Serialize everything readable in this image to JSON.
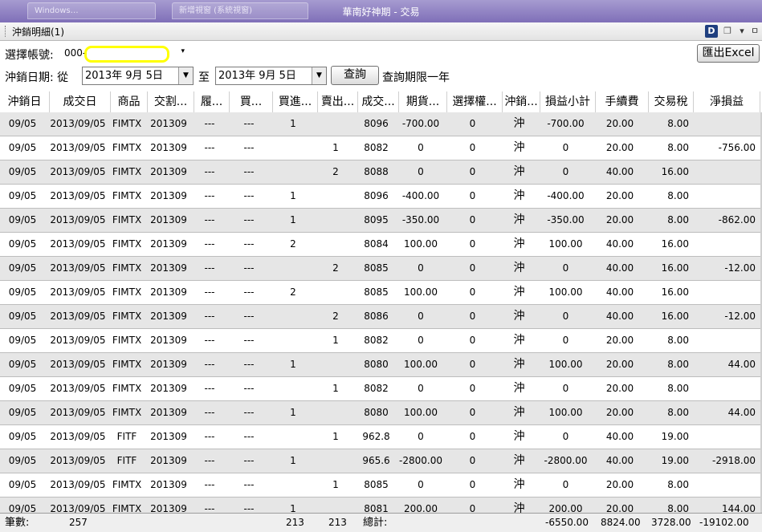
{
  "window": {
    "title": "華南好神期 - 交易",
    "tabs": [
      "Windows…",
      "新增視窗 (系統視窗)"
    ]
  },
  "panel": {
    "title": "沖銷明細(1)",
    "d_badge": "D",
    "window_glyph": "❐",
    "dropdown_glyph": "▾",
    "pin_glyph": "ㅁ"
  },
  "account": {
    "label": "選擇帳號:",
    "value": "000-",
    "arrow": "▾"
  },
  "export_button": "匯出Excel",
  "query": {
    "label": "沖銷日期: 從",
    "from": "2013年  9月  5日",
    "to_label": "至",
    "to": "2013年  9月  5日",
    "arrow": "▼",
    "button": "查詢",
    "note": "查詢期限一年"
  },
  "columns": [
    "沖銷日",
    "成交日",
    "商品",
    "交割...",
    "履...",
    "買...",
    "買進...",
    "賣出...",
    "成交...",
    "期貨...",
    "選擇權...",
    "沖銷...",
    "損益小計",
    "手續費",
    "交易稅",
    "淨損益"
  ],
  "rows": [
    [
      "09/05",
      "2013/09/05",
      "FIMTX",
      "201309",
      "---",
      "---",
      "1",
      "",
      "8096",
      "-700.00",
      "0",
      "沖",
      "-700.00",
      "20.00",
      "8.00",
      ""
    ],
    [
      "09/05",
      "2013/09/05",
      "FIMTX",
      "201309",
      "---",
      "---",
      "",
      "1",
      "8082",
      "0",
      "0",
      "沖",
      "0",
      "20.00",
      "8.00",
      "-756.00"
    ],
    [
      "09/05",
      "2013/09/05",
      "FIMTX",
      "201309",
      "---",
      "---",
      "",
      "2",
      "8088",
      "0",
      "0",
      "沖",
      "0",
      "40.00",
      "16.00",
      ""
    ],
    [
      "09/05",
      "2013/09/05",
      "FIMTX",
      "201309",
      "---",
      "---",
      "1",
      "",
      "8096",
      "-400.00",
      "0",
      "沖",
      "-400.00",
      "20.00",
      "8.00",
      ""
    ],
    [
      "09/05",
      "2013/09/05",
      "FIMTX",
      "201309",
      "---",
      "---",
      "1",
      "",
      "8095",
      "-350.00",
      "0",
      "沖",
      "-350.00",
      "20.00",
      "8.00",
      "-862.00"
    ],
    [
      "09/05",
      "2013/09/05",
      "FIMTX",
      "201309",
      "---",
      "---",
      "2",
      "",
      "8084",
      "100.00",
      "0",
      "沖",
      "100.00",
      "40.00",
      "16.00",
      ""
    ],
    [
      "09/05",
      "2013/09/05",
      "FIMTX",
      "201309",
      "---",
      "---",
      "",
      "2",
      "8085",
      "0",
      "0",
      "沖",
      "0",
      "40.00",
      "16.00",
      "-12.00"
    ],
    [
      "09/05",
      "2013/09/05",
      "FIMTX",
      "201309",
      "---",
      "---",
      "2",
      "",
      "8085",
      "100.00",
      "0",
      "沖",
      "100.00",
      "40.00",
      "16.00",
      ""
    ],
    [
      "09/05",
      "2013/09/05",
      "FIMTX",
      "201309",
      "---",
      "---",
      "",
      "2",
      "8086",
      "0",
      "0",
      "沖",
      "0",
      "40.00",
      "16.00",
      "-12.00"
    ],
    [
      "09/05",
      "2013/09/05",
      "FIMTX",
      "201309",
      "---",
      "---",
      "",
      "1",
      "8082",
      "0",
      "0",
      "沖",
      "0",
      "20.00",
      "8.00",
      ""
    ],
    [
      "09/05",
      "2013/09/05",
      "FIMTX",
      "201309",
      "---",
      "---",
      "1",
      "",
      "8080",
      "100.00",
      "0",
      "沖",
      "100.00",
      "20.00",
      "8.00",
      "44.00"
    ],
    [
      "09/05",
      "2013/09/05",
      "FIMTX",
      "201309",
      "---",
      "---",
      "",
      "1",
      "8082",
      "0",
      "0",
      "沖",
      "0",
      "20.00",
      "8.00",
      ""
    ],
    [
      "09/05",
      "2013/09/05",
      "FIMTX",
      "201309",
      "---",
      "---",
      "1",
      "",
      "8080",
      "100.00",
      "0",
      "沖",
      "100.00",
      "20.00",
      "8.00",
      "44.00"
    ],
    [
      "09/05",
      "2013/09/05",
      "FITF",
      "201309",
      "---",
      "---",
      "",
      "1",
      "962.8",
      "0",
      "0",
      "沖",
      "0",
      "40.00",
      "19.00",
      ""
    ],
    [
      "09/05",
      "2013/09/05",
      "FITF",
      "201309",
      "---",
      "---",
      "1",
      "",
      "965.6",
      "-2800.00",
      "0",
      "沖",
      "-2800.00",
      "40.00",
      "19.00",
      "-2918.00"
    ],
    [
      "09/05",
      "2013/09/05",
      "FIMTX",
      "201309",
      "---",
      "---",
      "",
      "1",
      "8085",
      "0",
      "0",
      "沖",
      "0",
      "20.00",
      "8.00",
      ""
    ],
    [
      "09/05",
      "2013/09/05",
      "FIMTX",
      "201309",
      "---",
      "---",
      "1",
      "",
      "8081",
      "200.00",
      "0",
      "沖",
      "200.00",
      "20.00",
      "8.00",
      "144.00"
    ]
  ],
  "footer": {
    "count_label": "筆數:",
    "count": "257",
    "buy_total": "213",
    "sell_total": "213",
    "total_label": "總計:",
    "pl_total": "-6550.00",
    "fee_total": "8824.00",
    "tax_total": "3728.00",
    "net_total": "-19102.00"
  },
  "colors": {
    "titlebar": "#8b7fc4",
    "row_alt": "#e6e6e6",
    "highlight": "#ffff00"
  }
}
